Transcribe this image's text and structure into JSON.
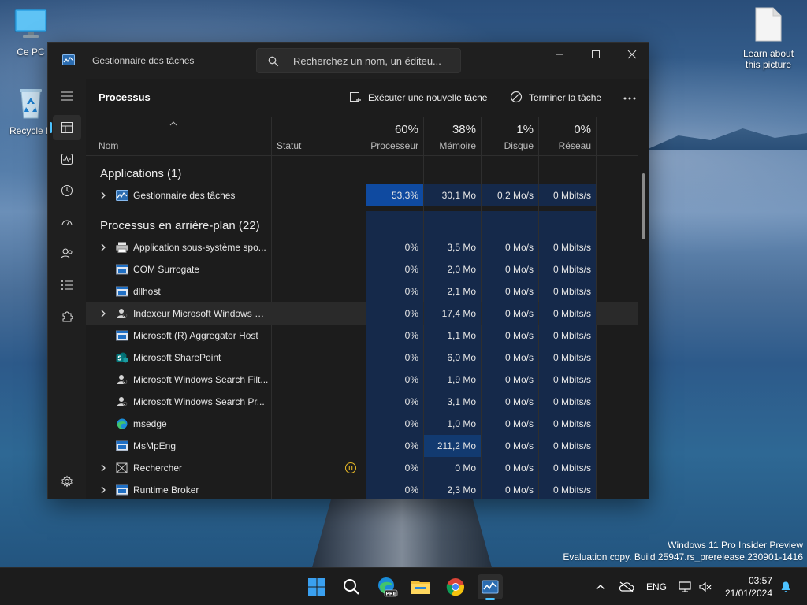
{
  "desktop": {
    "icons": [
      {
        "label": "Ce PC"
      },
      {
        "label": "Recycle B"
      },
      {
        "label": "Learn about this picture"
      }
    ],
    "watermark": {
      "line1": "Windows 11 Pro Insider Preview",
      "line2": "Evaluation copy. Build 25947.rs_prerelease.230901-1416"
    }
  },
  "window": {
    "title": "Gestionnaire des tâches",
    "search_placeholder": "Recherchez un nom, un éditeu...",
    "section_title": "Processus",
    "run_task_label": "Exécuter une nouvelle tâche",
    "end_task_label": "Terminer la tâche"
  },
  "columns": {
    "name": "Nom",
    "status": "Statut",
    "cpu": {
      "pct": "60%",
      "label": "Processeur"
    },
    "memory": {
      "pct": "38%",
      "label": "Mémoire"
    },
    "disk": {
      "pct": "1%",
      "label": "Disque"
    },
    "network": {
      "pct": "0%",
      "label": "Réseau"
    }
  },
  "groups": {
    "apps": "Applications (1)",
    "background": "Processus en arrière-plan (22)"
  },
  "apps": [
    {
      "name": "Gestionnaire des tâches",
      "cpu": "53,3%",
      "mem": "30,1 Mo",
      "disk": "0,2 Mo/s",
      "net": "0 Mbits/s",
      "expandable": true,
      "icon": "taskmgr-icon"
    }
  ],
  "background": [
    {
      "name": "Application sous-système spo...",
      "cpu": "0%",
      "mem": "3,5 Mo",
      "disk": "0 Mo/s",
      "net": "0 Mbits/s",
      "expandable": true,
      "icon": "printer-icon"
    },
    {
      "name": "COM Surrogate",
      "cpu": "0%",
      "mem": "2,0 Mo",
      "disk": "0 Mo/s",
      "net": "0 Mbits/s",
      "expandable": false,
      "icon": "window-icon"
    },
    {
      "name": "dllhost",
      "cpu": "0%",
      "mem": "2,1 Mo",
      "disk": "0 Mo/s",
      "net": "0 Mbits/s",
      "expandable": false,
      "icon": "window-icon"
    },
    {
      "name": "Indexeur Microsoft Windows S...",
      "cpu": "0%",
      "mem": "17,4 Mo",
      "disk": "0 Mo/s",
      "net": "0 Mbits/s",
      "expandable": true,
      "icon": "user-search-icon"
    },
    {
      "name": "Microsoft (R) Aggregator Host",
      "cpu": "0%",
      "mem": "1,1 Mo",
      "disk": "0 Mo/s",
      "net": "0 Mbits/s",
      "expandable": false,
      "icon": "window-icon"
    },
    {
      "name": "Microsoft SharePoint",
      "cpu": "0%",
      "mem": "6,0 Mo",
      "disk": "0 Mo/s",
      "net": "0 Mbits/s",
      "expandable": false,
      "icon": "sharepoint-icon"
    },
    {
      "name": "Microsoft Windows Search Filt...",
      "cpu": "0%",
      "mem": "1,9 Mo",
      "disk": "0 Mo/s",
      "net": "0 Mbits/s",
      "expandable": false,
      "icon": "user-search-icon"
    },
    {
      "name": "Microsoft Windows Search Pr...",
      "cpu": "0%",
      "mem": "3,1 Mo",
      "disk": "0 Mo/s",
      "net": "0 Mbits/s",
      "expandable": false,
      "icon": "user-search-icon"
    },
    {
      "name": "msedge",
      "cpu": "0%",
      "mem": "1,0 Mo",
      "disk": "0 Mo/s",
      "net": "0 Mbits/s",
      "expandable": false,
      "icon": "edge-icon"
    },
    {
      "name": "MsMpEng",
      "cpu": "0%",
      "mem": "211,2 Mo",
      "disk": "0 Mo/s",
      "net": "0 Mbits/s",
      "expandable": false,
      "icon": "window-icon"
    },
    {
      "name": "Rechercher",
      "cpu": "0%",
      "mem": "0 Mo",
      "disk": "0 Mo/s",
      "net": "0 Mbits/s",
      "expandable": true,
      "icon": "search-app-icon",
      "suspended": true
    },
    {
      "name": "Runtime Broker",
      "cpu": "0%",
      "mem": "2,3 Mo",
      "disk": "0 Mo/s",
      "net": "0 Mbits/s",
      "expandable": true,
      "icon": "window-icon"
    }
  ],
  "taskbar": {
    "language": "ENG",
    "time": "03:57",
    "date": "21/01/2024"
  },
  "colors": {
    "accent": "#4cc2ff",
    "heat_high": "#0f4aa0",
    "heat_mid": "#123a70",
    "heat_low": "#15294a",
    "pause": "#e3b526"
  }
}
